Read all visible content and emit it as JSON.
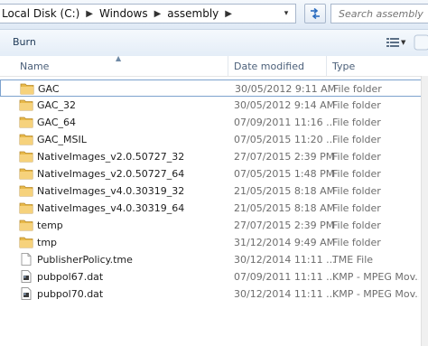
{
  "address": {
    "crumbs": [
      "Local Disk (C:)",
      "Windows",
      "assembly"
    ],
    "dropdown_glyph": "▾"
  },
  "search": {
    "placeholder": "Search assembly"
  },
  "toolbar": {
    "burn_label": "Burn"
  },
  "columns": {
    "name": "Name",
    "date": "Date modified",
    "type": "Type"
  },
  "files": [
    {
      "name": "GAC",
      "date": "30/05/2012 9:11 AM",
      "type": "File folder",
      "icon": "folder-icon"
    },
    {
      "name": "GAC_32",
      "date": "30/05/2012 9:14 AM",
      "type": "File folder",
      "icon": "folder-icon"
    },
    {
      "name": "GAC_64",
      "date": "07/09/2011 11:16 ...",
      "type": "File folder",
      "icon": "folder-icon"
    },
    {
      "name": "GAC_MSIL",
      "date": "07/05/2015 11:20 ...",
      "type": "File folder",
      "icon": "folder-icon"
    },
    {
      "name": "NativeImages_v2.0.50727_32",
      "date": "27/07/2015 2:39 PM",
      "type": "File folder",
      "icon": "folder-icon"
    },
    {
      "name": "NativeImages_v2.0.50727_64",
      "date": "07/05/2015 1:48 PM",
      "type": "File folder",
      "icon": "folder-icon"
    },
    {
      "name": "NativeImages_v4.0.30319_32",
      "date": "21/05/2015 8:18 AM",
      "type": "File folder",
      "icon": "folder-icon"
    },
    {
      "name": "NativeImages_v4.0.30319_64",
      "date": "21/05/2015 8:18 AM",
      "type": "File folder",
      "icon": "folder-icon"
    },
    {
      "name": "temp",
      "date": "27/07/2015 2:39 PM",
      "type": "File folder",
      "icon": "folder-icon"
    },
    {
      "name": "tmp",
      "date": "31/12/2014 9:49 AM",
      "type": "File folder",
      "icon": "folder-icon"
    },
    {
      "name": "PublisherPolicy.tme",
      "date": "30/12/2014 11:11 ...",
      "type": "TME File",
      "icon": "document-icon"
    },
    {
      "name": "pubpol67.dat",
      "date": "07/09/2011 11:11 ...",
      "type": "KMP - MPEG Mov...",
      "icon": "media-file-icon"
    },
    {
      "name": "pubpol70.dat",
      "date": "30/12/2014 11:11 ...",
      "type": "KMP - MPEG Mov...",
      "icon": "media-file-icon"
    }
  ],
  "colors": {
    "folder": "#e8b94a",
    "accent": "#2b5fa5",
    "selection_border": "#7da2ce"
  }
}
